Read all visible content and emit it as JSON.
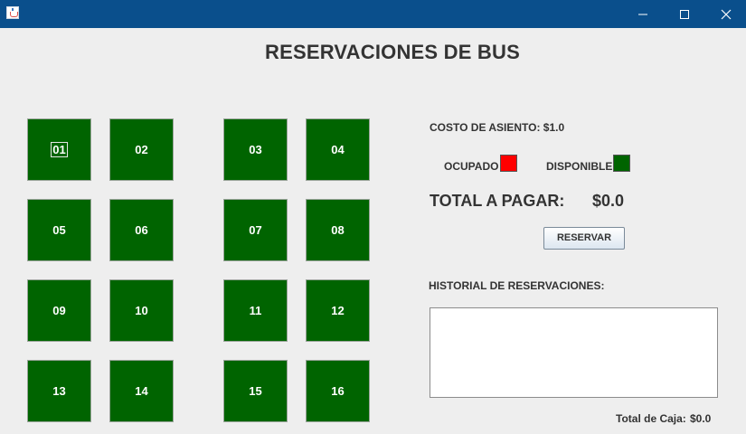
{
  "window": {
    "app_icon": "java-cup-icon",
    "controls": {
      "minimize": "minimize-icon",
      "maximize": "maximize-icon",
      "close": "close-icon"
    }
  },
  "title": "RESERVACIONES DE BUS",
  "seats": [
    "01",
    "02",
    "03",
    "04",
    "05",
    "06",
    "07",
    "08",
    "09",
    "10",
    "11",
    "12",
    "13",
    "14",
    "15",
    "16"
  ],
  "colors": {
    "available": "#006400",
    "occupied": "#ff0000",
    "titlebar": "#0a4f8c"
  },
  "info": {
    "cost_label": "COSTO DE ASIENTO: $1.0",
    "occupied_label": "OCUPADO",
    "available_label": "DISPONIBLE",
    "total_label": "TOTAL A PAGAR:",
    "total_value": "$0.0",
    "reserve_button": "RESERVAR",
    "history_label": "HISTORIAL DE RESERVACIONES:",
    "history_text": "",
    "cash_label": "Total de Caja:",
    "cash_value": "$0.0"
  }
}
